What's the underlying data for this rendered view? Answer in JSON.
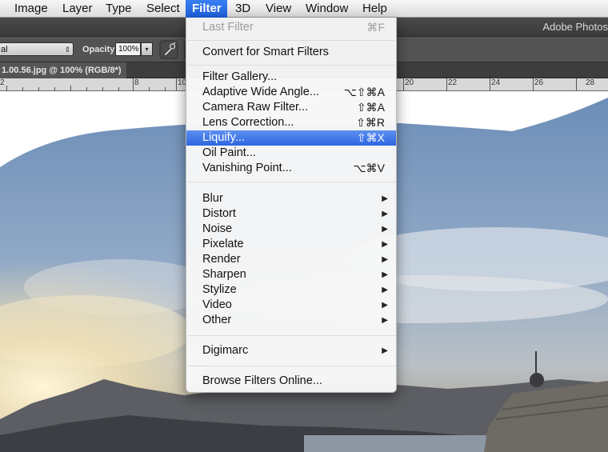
{
  "menubar": {
    "items": [
      {
        "label": "Image",
        "active": false
      },
      {
        "label": "Layer",
        "active": false
      },
      {
        "label": "Type",
        "active": false
      },
      {
        "label": "Select",
        "active": false
      },
      {
        "label": "Filter",
        "active": true
      },
      {
        "label": "3D",
        "active": false
      },
      {
        "label": "View",
        "active": false
      },
      {
        "label": "Window",
        "active": false
      },
      {
        "label": "Help",
        "active": false
      }
    ]
  },
  "appbar": {
    "title": "Adobe Photos"
  },
  "options": {
    "mode_value": "al",
    "opacity_label": "Opacity:",
    "opacity_value": "100%",
    "brush_icon": "airbrush-icon"
  },
  "document": {
    "tab_title": "1.00.56.jpg @ 100% (RGB/8*)"
  },
  "ruler": {
    "labels": [
      "2",
      "8",
      "10",
      "20",
      "22",
      "24",
      "26",
      "28"
    ]
  },
  "filter_menu": {
    "last_filter": {
      "label": "Last Filter",
      "shortcut": "⌘F"
    },
    "convert": {
      "label": "Convert for Smart Filters"
    },
    "gallery": {
      "label": "Filter Gallery..."
    },
    "adaptive": {
      "label": "Adaptive Wide Angle...",
      "shortcut": "⌥⇧⌘A"
    },
    "camera_raw": {
      "label": "Camera Raw Filter...",
      "shortcut": "⇧⌘A"
    },
    "lens": {
      "label": "Lens Correction...",
      "shortcut": "⇧⌘R"
    },
    "liquify": {
      "label": "Liquify...",
      "shortcut": "⇧⌘X"
    },
    "oil": {
      "label": "Oil Paint..."
    },
    "vanishing": {
      "label": "Vanishing Point...",
      "shortcut": "⌥⌘V"
    },
    "submenus": [
      "Blur",
      "Distort",
      "Noise",
      "Pixelate",
      "Render",
      "Sharpen",
      "Stylize",
      "Video",
      "Other"
    ],
    "digimarc": {
      "label": "Digimarc"
    },
    "browse": {
      "label": "Browse Filters Online..."
    },
    "arrow_glyph": "▶",
    "highlight_color": "#2d66e0"
  }
}
